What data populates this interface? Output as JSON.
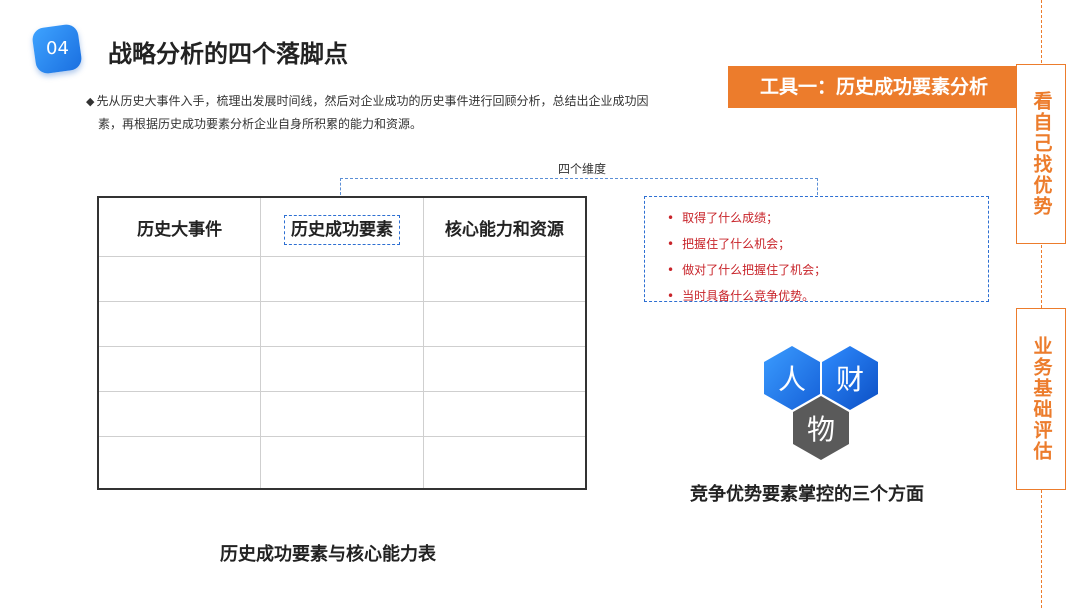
{
  "header": {
    "badge": "04",
    "title": "战略分析的四个落脚点"
  },
  "intro": {
    "bullet": "◆",
    "line1": "先从历史大事件入手，梳理出发展时间线，然后对企业成功的历史事件进行回顾分析，总结出企业成功因",
    "line2": "素，再根据历史成功要素分析企业自身所积累的能力和资源。"
  },
  "tool_banner": "工具一：历史成功要素分析",
  "side": {
    "box1": "看自己找优势",
    "box2": "业务基础评估"
  },
  "dimensions": {
    "label": "四个维度",
    "items": [
      "取得了什么成绩；",
      "把握住了什么机会；",
      "做对了什么把握住了机会；",
      "当时具备什么竞争优势。"
    ]
  },
  "table": {
    "headers": [
      "历史大事件",
      "历史成功要素",
      "核心能力和资源"
    ],
    "caption": "历史成功要素与核心能力表"
  },
  "factors": {
    "hex1": "人",
    "hex2": "财",
    "hex3": "物",
    "caption": "竞争优势要素掌控的三个方面"
  },
  "colors": {
    "accent_orange": "#ec7c2c",
    "accent_blue": "#2d6fd2",
    "text_red": "#c8242a",
    "hex_dark": "#5a5a5a"
  }
}
